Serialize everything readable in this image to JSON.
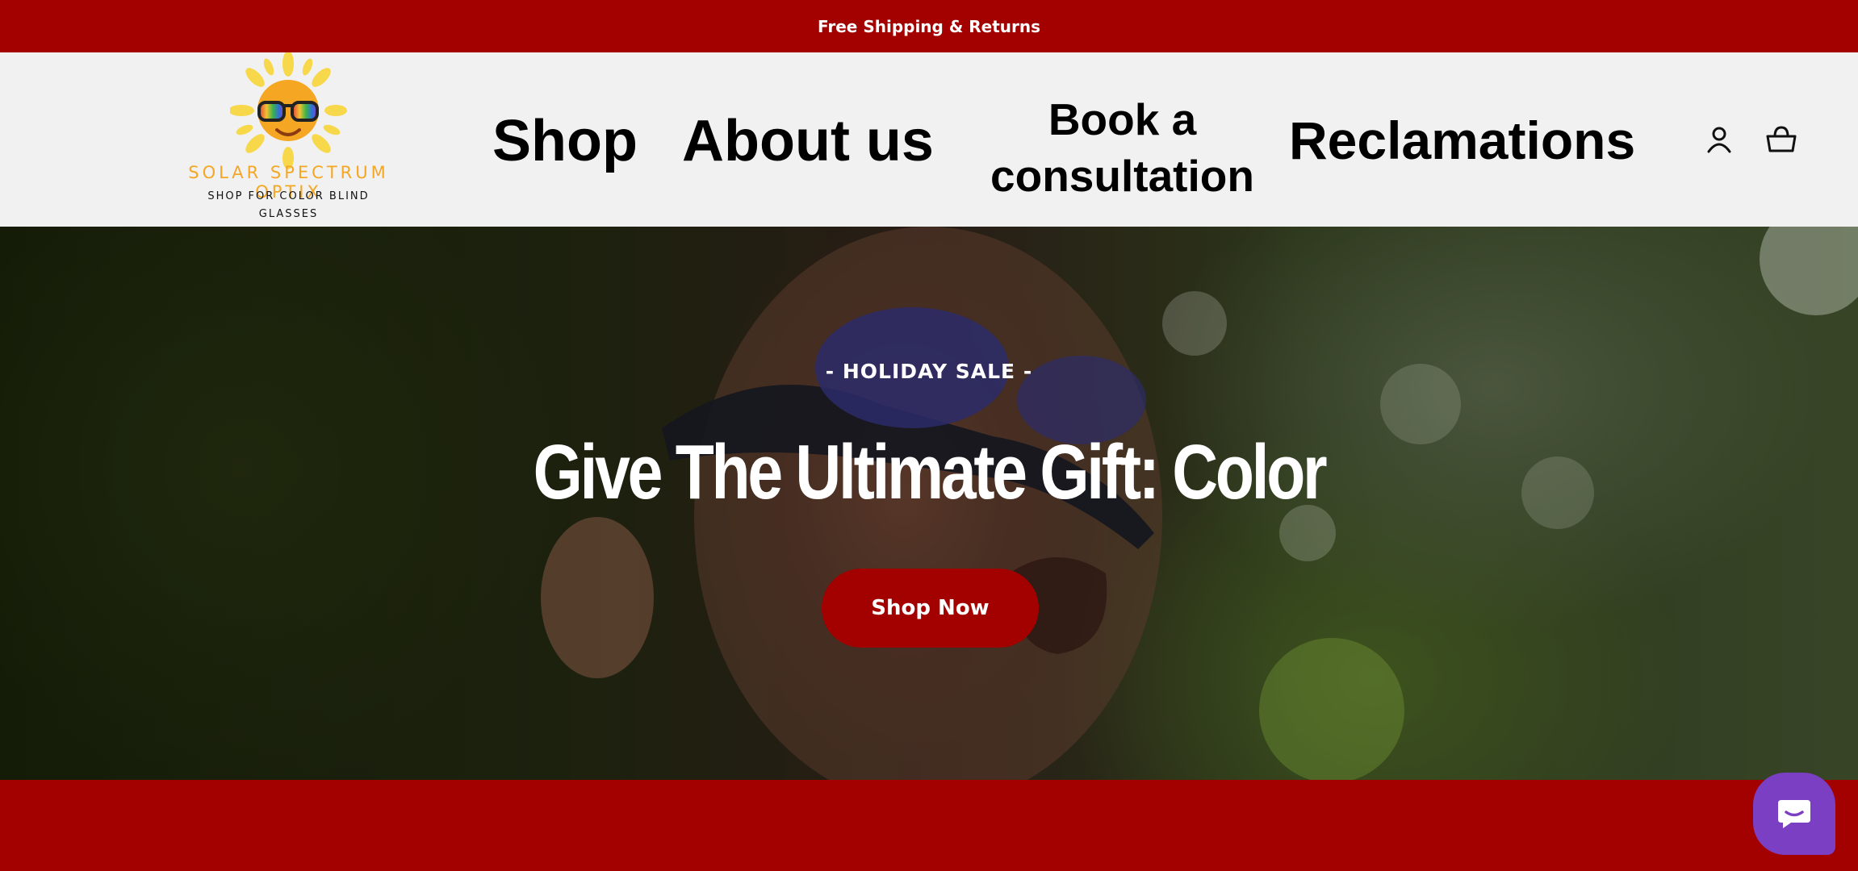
{
  "announcement": {
    "text": "Free Shipping & Returns"
  },
  "logo": {
    "brand": "SOLAR SPECTRUM OPTIX",
    "tagline": "SHOP FOR COLOR BLIND GLASSES",
    "icon": "sun-with-sunglasses-icon"
  },
  "nav": {
    "shop": "Shop",
    "about": "About us",
    "book": "Book a consultation",
    "reclamations": "Reclamations"
  },
  "header_icons": {
    "account": "user-icon",
    "cart": "basket-icon"
  },
  "hero": {
    "eyebrow": "- HOLIDAY SALE -",
    "title": "Give The Ultimate Gift: Color",
    "cta": "Shop Now"
  },
  "chat": {
    "icon": "chat-bubble-icon"
  },
  "colors": {
    "brand_red": "#a30000",
    "header_bg": "#f1f1f1",
    "logo_orange": "#f5a623",
    "chat_purple": "#7b3fc4"
  }
}
